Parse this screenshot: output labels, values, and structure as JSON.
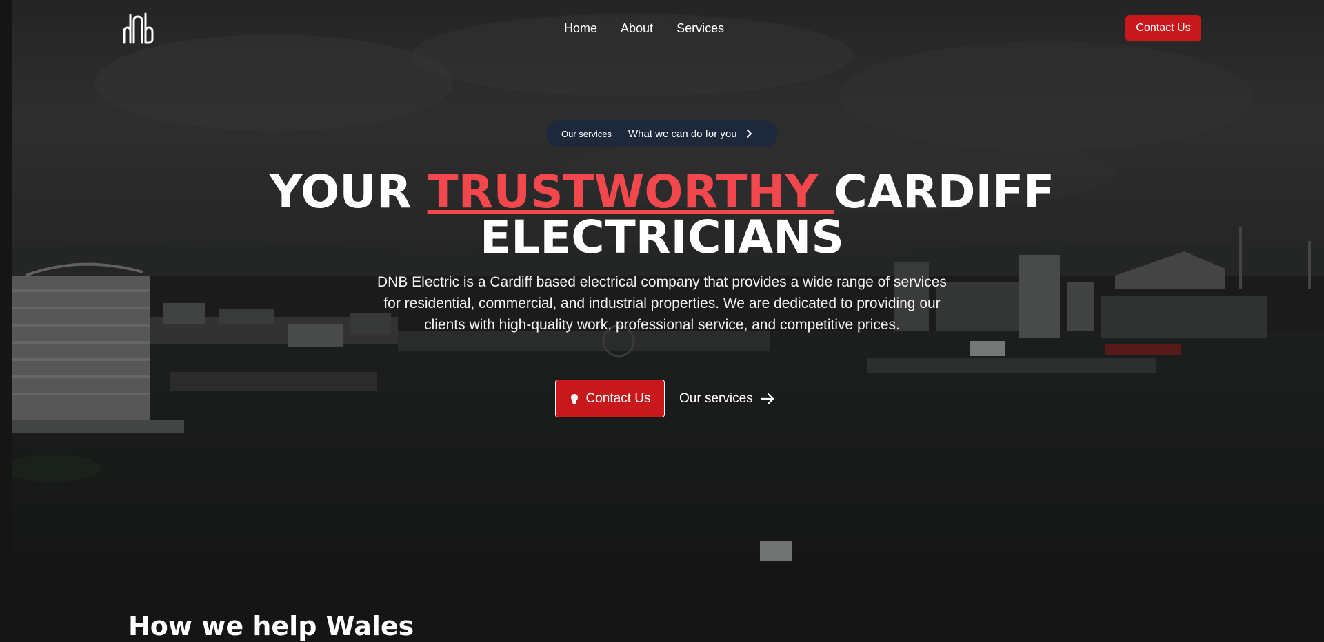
{
  "nav": {
    "logo_icon": "dnb-logo-icon",
    "links": [
      "Home",
      "About",
      "Services"
    ],
    "cta_label": "Contact Us"
  },
  "hero": {
    "pill_tag": "Our services",
    "pill_text": "What we can do for you",
    "headline_part1": "YOUR ",
    "headline_accent": "TRUSTWORTHY ",
    "headline_part2": "CARDIFF",
    "headline_line2": "ELECTRICIANS",
    "lead": "DNB Electric is a Cardiff based electrical company that provides a wide range of services for residential, commercial, and industrial properties. We are dedicated to providing our clients with high-quality work, professional service, and competitive prices.",
    "primary_cta": "Contact Us",
    "secondary_cta": "Our services"
  },
  "section": {
    "title": "How we help Wales"
  },
  "colors": {
    "accent_red": "#c8181c",
    "headline_accent": "#f2474c",
    "page_bg": "#151515",
    "pill_bg": "#1c283c"
  }
}
